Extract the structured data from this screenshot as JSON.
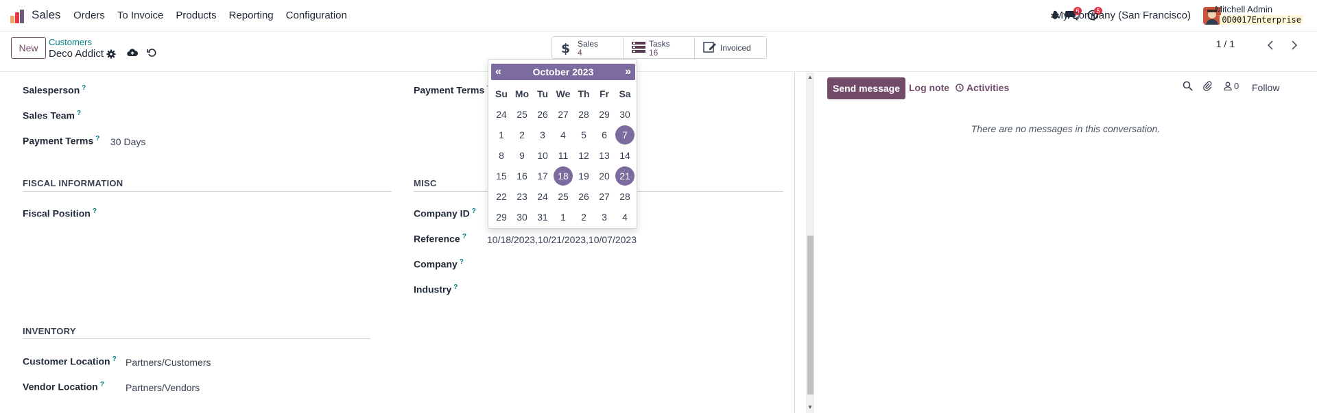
{
  "navbar": {
    "app_name": "Sales",
    "menu": [
      "Orders",
      "To Invoice",
      "Products",
      "Reporting",
      "Configuration"
    ],
    "messages_badge": "6",
    "activities_badge": "5",
    "company": "My Company (San Francisco)",
    "user_name": "Mitchell Admin",
    "db_name": "0D0017Enterprise",
    "icons": {
      "bug": "bug-icon",
      "chat": "chat-icon",
      "activity": "clock-icon"
    }
  },
  "control": {
    "new_label": "New",
    "breadcrumb_parent": "Customers",
    "breadcrumb_current": "Deco Addict",
    "smart_buttons": [
      {
        "label": "Sales",
        "value": "4",
        "icon": "dollar-icon"
      },
      {
        "label": "Tasks",
        "value": "16",
        "icon": "tasks-icon"
      },
      {
        "label": "Invoiced",
        "value": "",
        "icon": "invoice-icon"
      }
    ],
    "pager": "1 / 1"
  },
  "form": {
    "salesperson_label": "Salesperson",
    "sales_team_label": "Sales Team",
    "payment_terms_label": "Payment Terms",
    "payment_terms_value": "30 Days",
    "payment_terms_right_label": "Payment Terms",
    "fiscal_section": "FISCAL INFORMATION",
    "fiscal_position_label": "Fiscal Position",
    "misc_section": "MISC",
    "company_id_label": "Company ID",
    "reference_label": "Reference",
    "reference_value": "10/18/2023,10/21/2023,10/07/2023",
    "company_label": "Company",
    "industry_label": "Industry",
    "inventory_section": "INVENTORY",
    "customer_location_label": "Customer Location",
    "customer_location_value": "Partners/Customers",
    "vendor_location_label": "Vendor Location",
    "vendor_location_value": "Partners/Vendors",
    "help_mark": "?"
  },
  "chatter": {
    "send_message": "Send message",
    "log_note": "Log note",
    "activities": "Activities",
    "followers_count": "0",
    "follow": "Follow",
    "empty": "There are no messages in this conversation."
  },
  "datepicker": {
    "prev": "«",
    "next": "»",
    "title": "October 2023",
    "weekdays": [
      "Su",
      "Mo",
      "Tu",
      "We",
      "Th",
      "Fr",
      "Sa"
    ],
    "weeks": [
      [
        "24",
        "25",
        "26",
        "27",
        "28",
        "29",
        "30"
      ],
      [
        "1",
        "2",
        "3",
        "4",
        "5",
        "6",
        "7"
      ],
      [
        "8",
        "9",
        "10",
        "11",
        "12",
        "13",
        "14"
      ],
      [
        "15",
        "16",
        "17",
        "18",
        "19",
        "20",
        "21"
      ],
      [
        "22",
        "23",
        "24",
        "25",
        "26",
        "27",
        "28"
      ],
      [
        "29",
        "30",
        "31",
        "1",
        "2",
        "3",
        "4"
      ]
    ],
    "selected_days": [
      "7",
      "18",
      "21"
    ],
    "accent_color": "#7b6b9e"
  },
  "colors": {
    "brand": "#714b67",
    "link": "#017e84",
    "badge": "#dc3545"
  }
}
